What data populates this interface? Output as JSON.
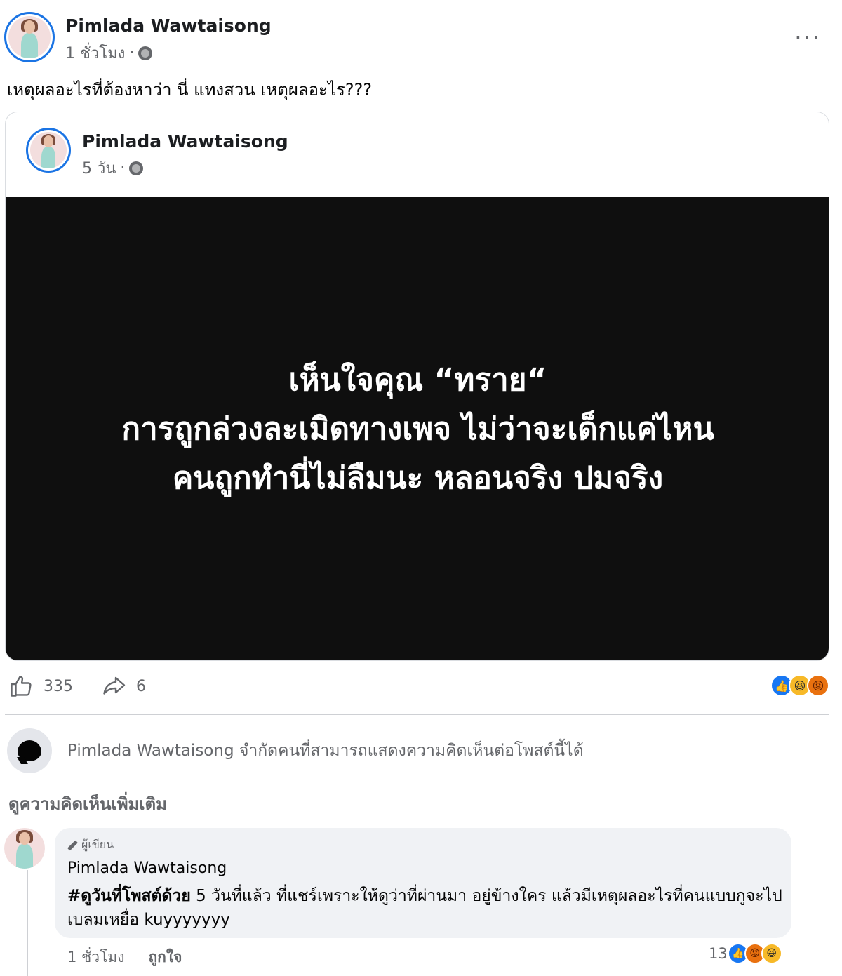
{
  "post": {
    "author": "Pimlada Wawtaisong",
    "time": "1 ชั่วโมง",
    "separator": "·",
    "text": "เหตุผลอะไรที่ต้องหาว่า นี่ แทงสวน เหตุผลอะไร???",
    "more_label": "···"
  },
  "shared": {
    "author": "Pimlada Wawtaisong",
    "time": "5 วัน",
    "separator": "·",
    "image_lines": [
      "เห็นใจคุณ “ทราย“",
      "การถูกล่วงละเมิดทางเพจ ไม่ว่าจะเด็กแค่ไหน",
      "คนถูกทำนี่ไม่ลืมนะ หลอนจริง ปมจริง"
    ]
  },
  "stats": {
    "likes": "335",
    "shares": "6",
    "reaction_icons": [
      "like-icon",
      "haha-icon",
      "angry-icon"
    ]
  },
  "restriction": {
    "text": "Pimlada Wawtaisong จำกัดคนที่สามารถแสดงความคิดเห็นต่อโพสต์นี้ได้"
  },
  "more_comments": "ดูความคิดเห็นเพิ่มเติม",
  "comment": {
    "badge": "ผู้เขียน",
    "author": "Pimlada Wawtaisong",
    "hashtag": "#ดูวันที่โพสต์ด้วย",
    "text": " 5 วันที่แล้ว ที่แชร์เพราะให้ดูว่าที่ผ่านมา อยู่ข้างใคร แล้วมีเหตุผลอะไรที่คนแบบกูจะไปเบลมเหยื่อ kuyyyyyyy",
    "time": "1 ชั่วโมง",
    "like_label": "ถูกใจ",
    "reaction_count": "13"
  },
  "colors": {
    "accent": "#1877f2",
    "image_bg": "#0f0f0f",
    "muted_text": "#65676b"
  }
}
